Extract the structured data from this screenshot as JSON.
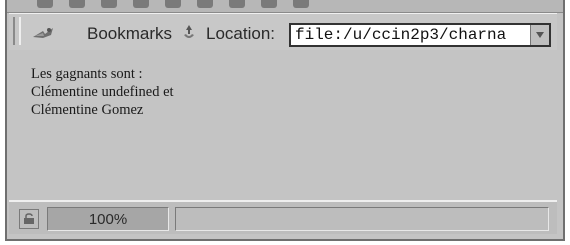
{
  "toolbar": {
    "bookmarks_label": "Bookmarks",
    "location_label": "Location:",
    "location_value": "file:/u/ccin2p3/charna"
  },
  "content": {
    "lines": [
      "Les gagnants sont :",
      "Clémentine undefined et",
      "Clémentine Gomez"
    ]
  },
  "statusbar": {
    "progress_label": "100%",
    "status_text": ""
  }
}
